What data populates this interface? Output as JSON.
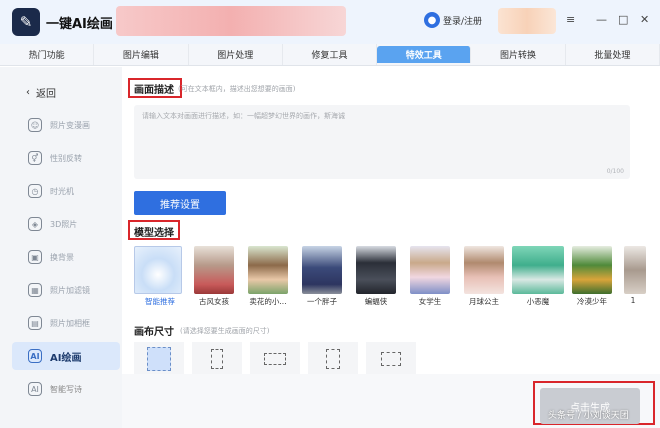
{
  "app": {
    "title": "一键AI绘画",
    "logo_glyph": "✎"
  },
  "header": {
    "login_label": "登录/注册",
    "user_icon": "user-icon",
    "menu_icon": "≡",
    "minimize_icon": "—",
    "maximize_icon": "□",
    "close_icon": "✕"
  },
  "tabs": [
    {
      "label": "热门功能"
    },
    {
      "label": "图片编辑"
    },
    {
      "label": "图片处理"
    },
    {
      "label": "修复工具"
    },
    {
      "label": "特效工具",
      "active": true
    },
    {
      "label": "图片转换"
    },
    {
      "label": "批量处理"
    }
  ],
  "sidebar": {
    "back_label": "返回",
    "items": [
      {
        "label": "照片变漫画",
        "icon": "☺"
      },
      {
        "label": "性别反转",
        "icon": "⚥"
      },
      {
        "label": "时光机",
        "icon": "◷"
      },
      {
        "label": "3D照片",
        "icon": "◈"
      },
      {
        "label": "换背景",
        "icon": "▣"
      },
      {
        "label": "照片加滤镜",
        "icon": "▦"
      },
      {
        "label": "照片加相框",
        "icon": "▤"
      },
      {
        "label": "AI绘画",
        "icon": "AI",
        "active": true
      },
      {
        "label": "智能写诗",
        "icon": "AI"
      }
    ]
  },
  "prompt": {
    "title": "画面描述",
    "hint": "(可在文本框内，描述出您想要的画面)",
    "placeholder": "请输入文本对画面进行描述，如：一幅超梦幻世界的画作，斯海诚",
    "counter": "0/100"
  },
  "recommend_button": "推荐设置",
  "models": {
    "title": "模型选择",
    "items": [
      {
        "label": "智能推荐",
        "selected": true
      },
      {
        "label": "古风女孩"
      },
      {
        "label": "卖花的小..."
      },
      {
        "label": "一个胖子"
      },
      {
        "label": "蝙蝠侠"
      },
      {
        "label": "女学生"
      },
      {
        "label": "月球公主"
      },
      {
        "label": "小恶魔"
      },
      {
        "label": "冷漠少年"
      },
      {
        "label": "1"
      }
    ]
  },
  "canvas": {
    "title": "画布尺寸",
    "hint": "(请选择您要生成画面的尺寸)"
  },
  "generate_button": "点击生成",
  "watermark": "头条号 / 小刘谈天团",
  "colors": {
    "accent": "#2f6fe0",
    "highlight": "#d9262b",
    "active_tab": "#5aa3f0"
  }
}
